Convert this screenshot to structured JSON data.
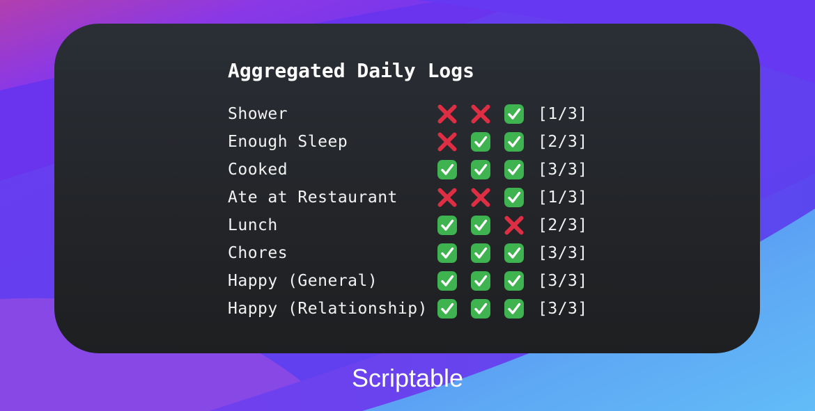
{
  "wallpaper": {
    "colors": {
      "pink": "#b23fae",
      "violet": "#7a34ee",
      "purple": "#6536f0",
      "indigo": "#5a3ef2",
      "blue": "#5d9cf2",
      "light_blue": "#5fb8f6"
    }
  },
  "widget": {
    "title": "Aggregated Daily Logs",
    "background": "#24272c",
    "check_color": "#3fb34f",
    "cross_color": "#dd2e44",
    "rows": [
      {
        "label": "Shower",
        "marks": [
          "cross-icon",
          "cross-icon",
          "check-icon"
        ],
        "count": "[1/3]"
      },
      {
        "label": "Enough Sleep",
        "marks": [
          "cross-icon",
          "check-icon",
          "check-icon"
        ],
        "count": "[2/3]"
      },
      {
        "label": "Cooked",
        "marks": [
          "check-icon",
          "check-icon",
          "check-icon"
        ],
        "count": "[3/3]"
      },
      {
        "label": "Ate at Restaurant",
        "marks": [
          "cross-icon",
          "cross-icon",
          "check-icon"
        ],
        "count": "[1/3]"
      },
      {
        "label": "Lunch",
        "marks": [
          "check-icon",
          "check-icon",
          "cross-icon"
        ],
        "count": "[2/3]"
      },
      {
        "label": "Chores",
        "marks": [
          "check-icon",
          "check-icon",
          "check-icon"
        ],
        "count": "[3/3]"
      },
      {
        "label": "Happy (General)",
        "marks": [
          "check-icon",
          "check-icon",
          "check-icon"
        ],
        "count": "[3/3]"
      },
      {
        "label": "Happy (Relationship)",
        "marks": [
          "check-icon",
          "check-icon",
          "check-icon"
        ],
        "count": "[3/3]"
      }
    ]
  },
  "app": {
    "label": "Scriptable"
  }
}
